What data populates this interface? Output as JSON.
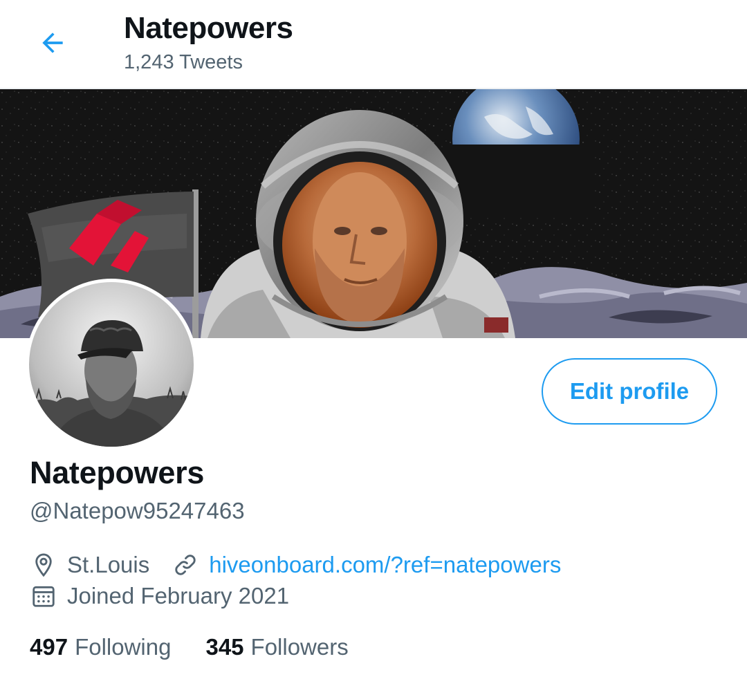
{
  "header": {
    "title": "Natepowers",
    "tweet_count": "1,243 Tweets",
    "back_icon": "arrow-left-icon"
  },
  "profile": {
    "display_name": "Natepowers",
    "handle": "@Natepow95247463",
    "edit_button": "Edit profile",
    "location": "St.Louis",
    "website": "hiveonboard.com/?ref=natepowers",
    "joined": "Joined February 2021"
  },
  "stats": {
    "following_count": "497",
    "following_label": "Following",
    "followers_count": "345",
    "followers_label": "Followers"
  },
  "colors": {
    "accent": "#1d9bf0",
    "text_primary": "#0f1419",
    "text_secondary": "#536471"
  }
}
